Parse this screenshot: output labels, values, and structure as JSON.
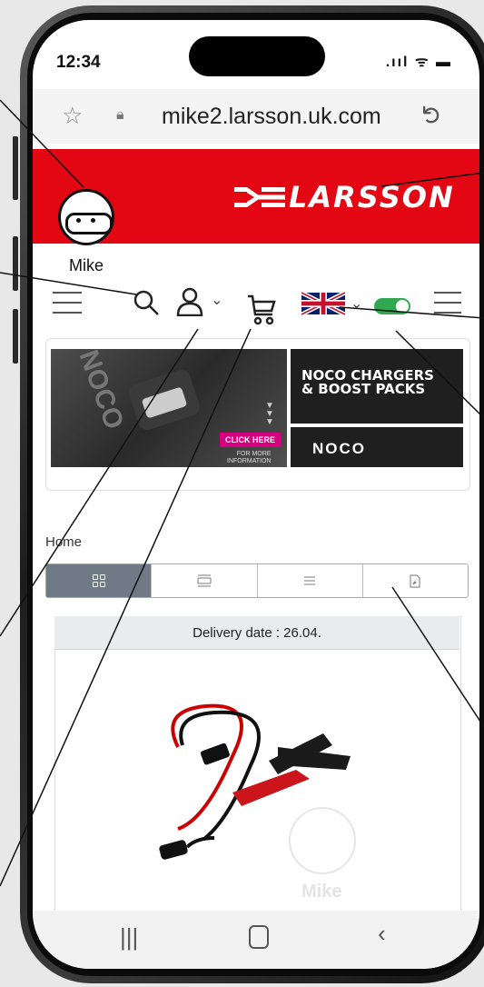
{
  "status": {
    "time": "12:34",
    "icons": ".ııl ᯤ ▬"
  },
  "browser": {
    "url": "mike2.larsson.uk.com"
  },
  "header": {
    "brand": "LARSSON"
  },
  "mascot": {
    "label": "Mike"
  },
  "banner": {
    "title_line1": "NOCO CHARGERS",
    "title_line2": "& BOOST PACKS",
    "brand": "NOCO",
    "photo_brand": "NOCO",
    "cta": "CLICK HERE",
    "more_info_line1": "FOR MORE",
    "more_info_line2": "INFORMATION"
  },
  "breadcrumb": {
    "home": "Home"
  },
  "view_tabs": [
    "grid",
    "list-image",
    "list",
    "pdf"
  ],
  "product": {
    "delivery": "Delivery date : 26.04.",
    "watermark": "Mike"
  },
  "colors": {
    "accent_red": "#e30613",
    "toggle_green": "#2fa84f",
    "active_tab": "#707a86"
  },
  "icons": [
    "hamburger-menu-icon",
    "search-icon",
    "user-icon",
    "cart-icon",
    "uk-flag-icon",
    "toggle-icon",
    "star-icon",
    "lock-icon",
    "reload-icon"
  ]
}
